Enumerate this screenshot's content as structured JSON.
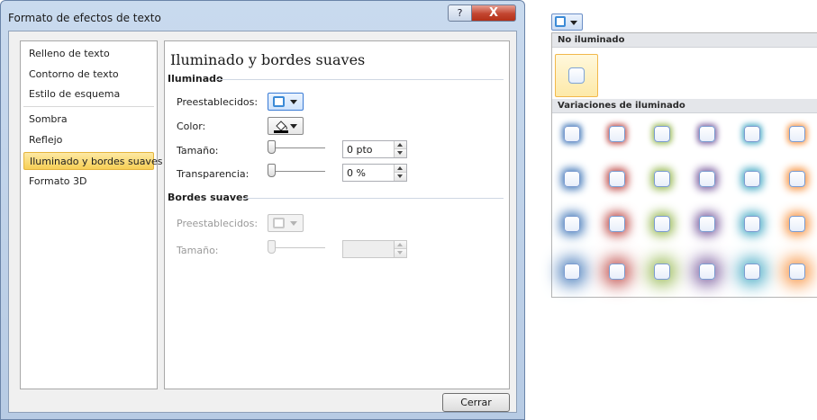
{
  "dialog": {
    "title": "Formato de efectos de texto",
    "help_glyph": "?",
    "close_glyph": "X",
    "close_button": "Cerrar"
  },
  "nav": {
    "items": [
      {
        "label": "Relleno de texto",
        "selected": false
      },
      {
        "label": "Contorno de texto",
        "selected": false
      },
      {
        "label": "Estilo de esquema",
        "selected": false
      },
      {
        "label": "Sombra",
        "selected": false
      },
      {
        "label": "Reflejo",
        "selected": false
      },
      {
        "label": "Iluminado y bordes suaves",
        "selected": true
      },
      {
        "label": "Formato 3D",
        "selected": false
      }
    ]
  },
  "panel": {
    "title": "Iluminado y bordes suaves",
    "glow": {
      "heading": "Iluminado",
      "presets_label": "Preestablecidos:",
      "color_label": "Color:",
      "size_label": "Tamaño:",
      "size_value": "0 pto",
      "transparency_label": "Transparencia:",
      "transparency_value": "0 %"
    },
    "soft_edges": {
      "heading": "Bordes suaves",
      "presets_label": "Preestablecidos:",
      "size_label": "Tamaño:",
      "size_value": ""
    }
  },
  "gallery": {
    "no_glow_heading": "No iluminado",
    "variations_heading": "Variaciones de iluminado",
    "colors": [
      "#4f81bd",
      "#c0504d",
      "#9bbb59",
      "#8064a2",
      "#4bacc6",
      "#f79646"
    ],
    "glow_sizes_pt": [
      5,
      8,
      11,
      18
    ]
  },
  "colors": {
    "selection": "#f7cf55",
    "accent": "#3b8ad6"
  }
}
